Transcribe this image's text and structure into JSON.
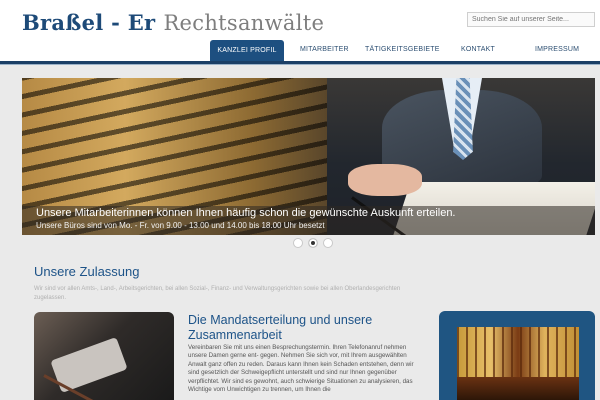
{
  "header": {
    "logo_part1": "Braßel - Er",
    "logo_part2": "Rechtsanwälte",
    "search_placeholder": "Suchen Sie auf unserer Seite..."
  },
  "nav": {
    "items": [
      {
        "label": "KANZLEI PROFIL",
        "active": true
      },
      {
        "label": "MITARBEITER"
      },
      {
        "label": "TÄTIGKEITSGEBIETE"
      },
      {
        "label": "KONTAKT"
      },
      {
        "label": "IMPRESSUM"
      }
    ]
  },
  "slider": {
    "caption_title": "Unsere Mitarbeiterinnen können Ihnen häufig schon die gewünschte Auskunft erteilen.",
    "caption_sub": "Unsere Büros sind von Mo. - Fr. von 9.00 - 13.00 und 14.00 bis 18.00 Uhr besetzt",
    "dots": 3,
    "active_dot": 2
  },
  "section": {
    "title": "Unsere Zulassung",
    "text": "Wir sind vor allen Amts-, Land-, Arbeitsgerichten, bei allen Sozial-, Finanz- und Verwaltungsgerichten sowie bei allen Oberlandesgerichten zugelassen."
  },
  "article": {
    "title": "Die Mandatserteilung und unsere Zusammenarbeit",
    "text": "Vereinbaren Sie mit uns einen Besprechungstermin. Ihren Telefonanruf nehmen unsere Damen gerne ent- gegen. Nehmen Sie sich vor, mit Ihrem ausgewählten Anwalt ganz offen zu reden. Daraus kann Ihnen kein Schaden entstehen, denn wir sind gesetzlich der Schweigepflicht unterstellt und sind nur Ihnen gegenüber verpflichtet. Wir sind es gewohnt, auch schwierige Situationen zu analysieren, das Wichtige vom Unwichtigen zu trennen, um Ihnen die"
  }
}
